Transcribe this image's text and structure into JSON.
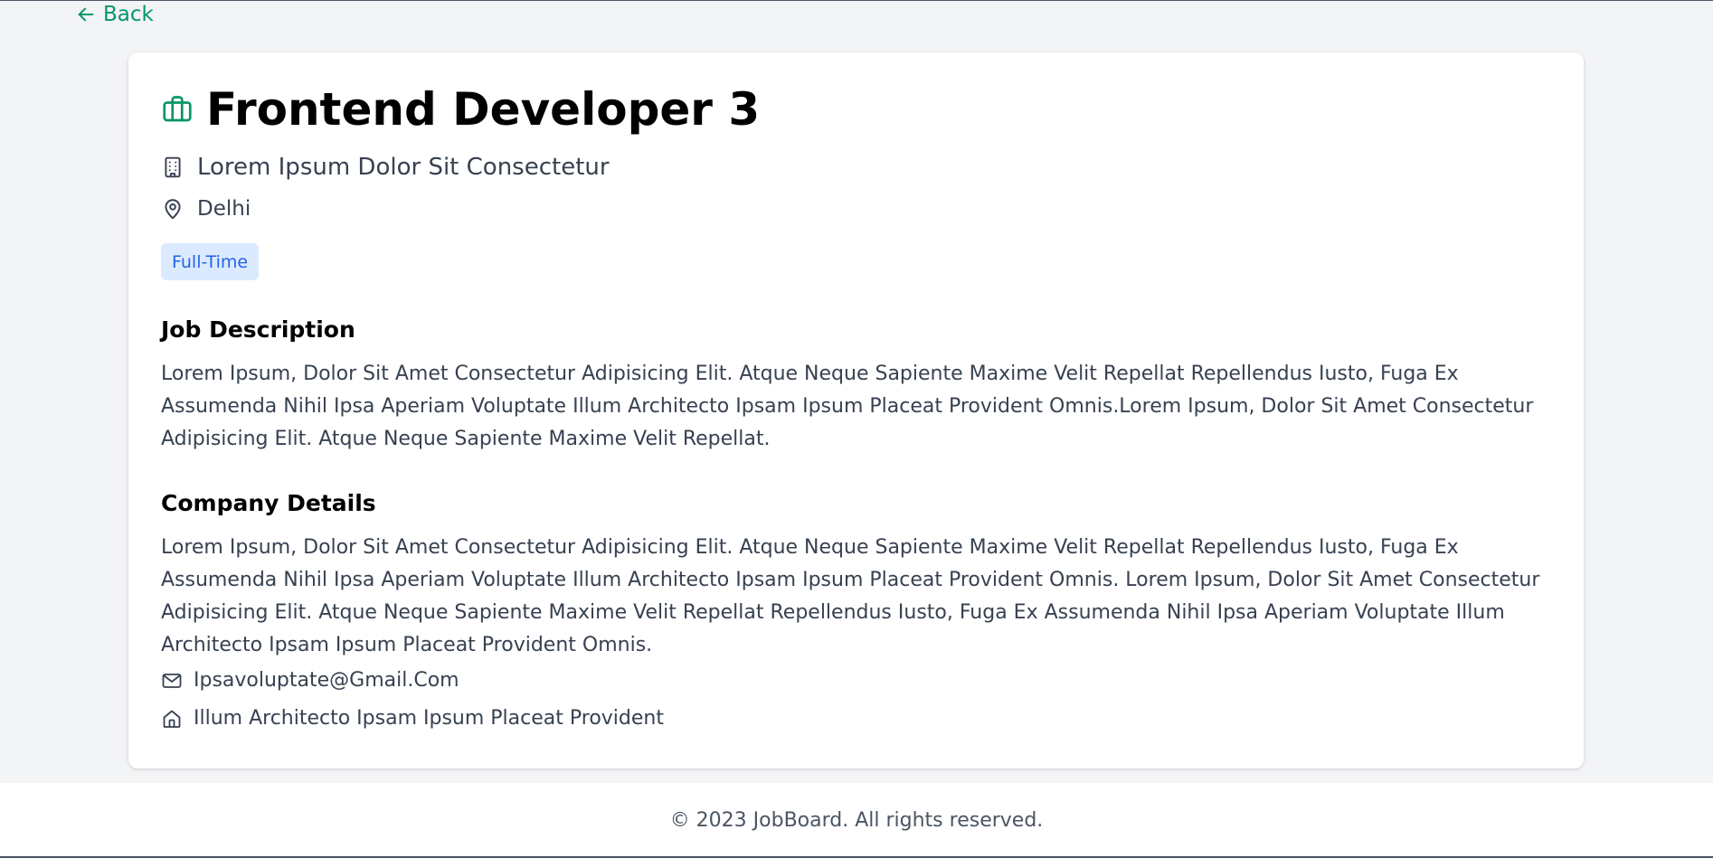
{
  "nav": {
    "back_label": "Back",
    "back_icon": "arrow-left-icon"
  },
  "job": {
    "title": "Frontend Developer 3",
    "title_icon": "briefcase-icon",
    "company": "Lorem Ipsum Dolor Sit Consectetur",
    "company_icon": "building-icon",
    "location": "Delhi",
    "location_icon": "map-pin-icon",
    "type_badge": "Full-Time"
  },
  "description": {
    "heading": "Job Description",
    "text": "Lorem Ipsum, Dolor Sit Amet Consectetur Adipisicing Elit. Atque Neque Sapiente Maxime Velit Repellat Repellendus Iusto, Fuga Ex Assumenda Nihil Ipsa Aperiam Voluptate Illum Architecto Ipsam Ipsum Placeat Provident Omnis.Lorem Ipsum, Dolor Sit Amet Consectetur Adipisicing Elit. Atque Neque Sapiente Maxime Velit Repellat."
  },
  "company_details": {
    "heading": "Company Details",
    "text": "Lorem Ipsum, Dolor Sit Amet Consectetur Adipisicing Elit. Atque Neque Sapiente Maxime Velit Repellat Repellendus Iusto, Fuga Ex Assumenda Nihil Ipsa Aperiam Voluptate Illum Architecto Ipsam Ipsum Placeat Provident Omnis. Lorem Ipsum, Dolor Sit Amet Consectetur Adipisicing Elit. Atque Neque Sapiente Maxime Velit Repellat Repellendus Iusto, Fuga Ex Assumenda Nihil Ipsa Aperiam Voluptate Illum Architecto Ipsam Ipsum Placeat Provident Omnis.",
    "email": "Ipsavoluptate@Gmail.Com",
    "email_icon": "mail-icon",
    "address": "Illum Architecto Ipsam Ipsum Placeat Provident",
    "address_icon": "home-icon"
  },
  "footer": {
    "copyright": "© 2023 JobBoard. All rights reserved."
  },
  "colors": {
    "accent": "#059669",
    "badge_bg": "#dbeafe",
    "badge_text": "#2563eb",
    "page_bg": "#f3f4f6",
    "card_bg": "#ffffff"
  }
}
